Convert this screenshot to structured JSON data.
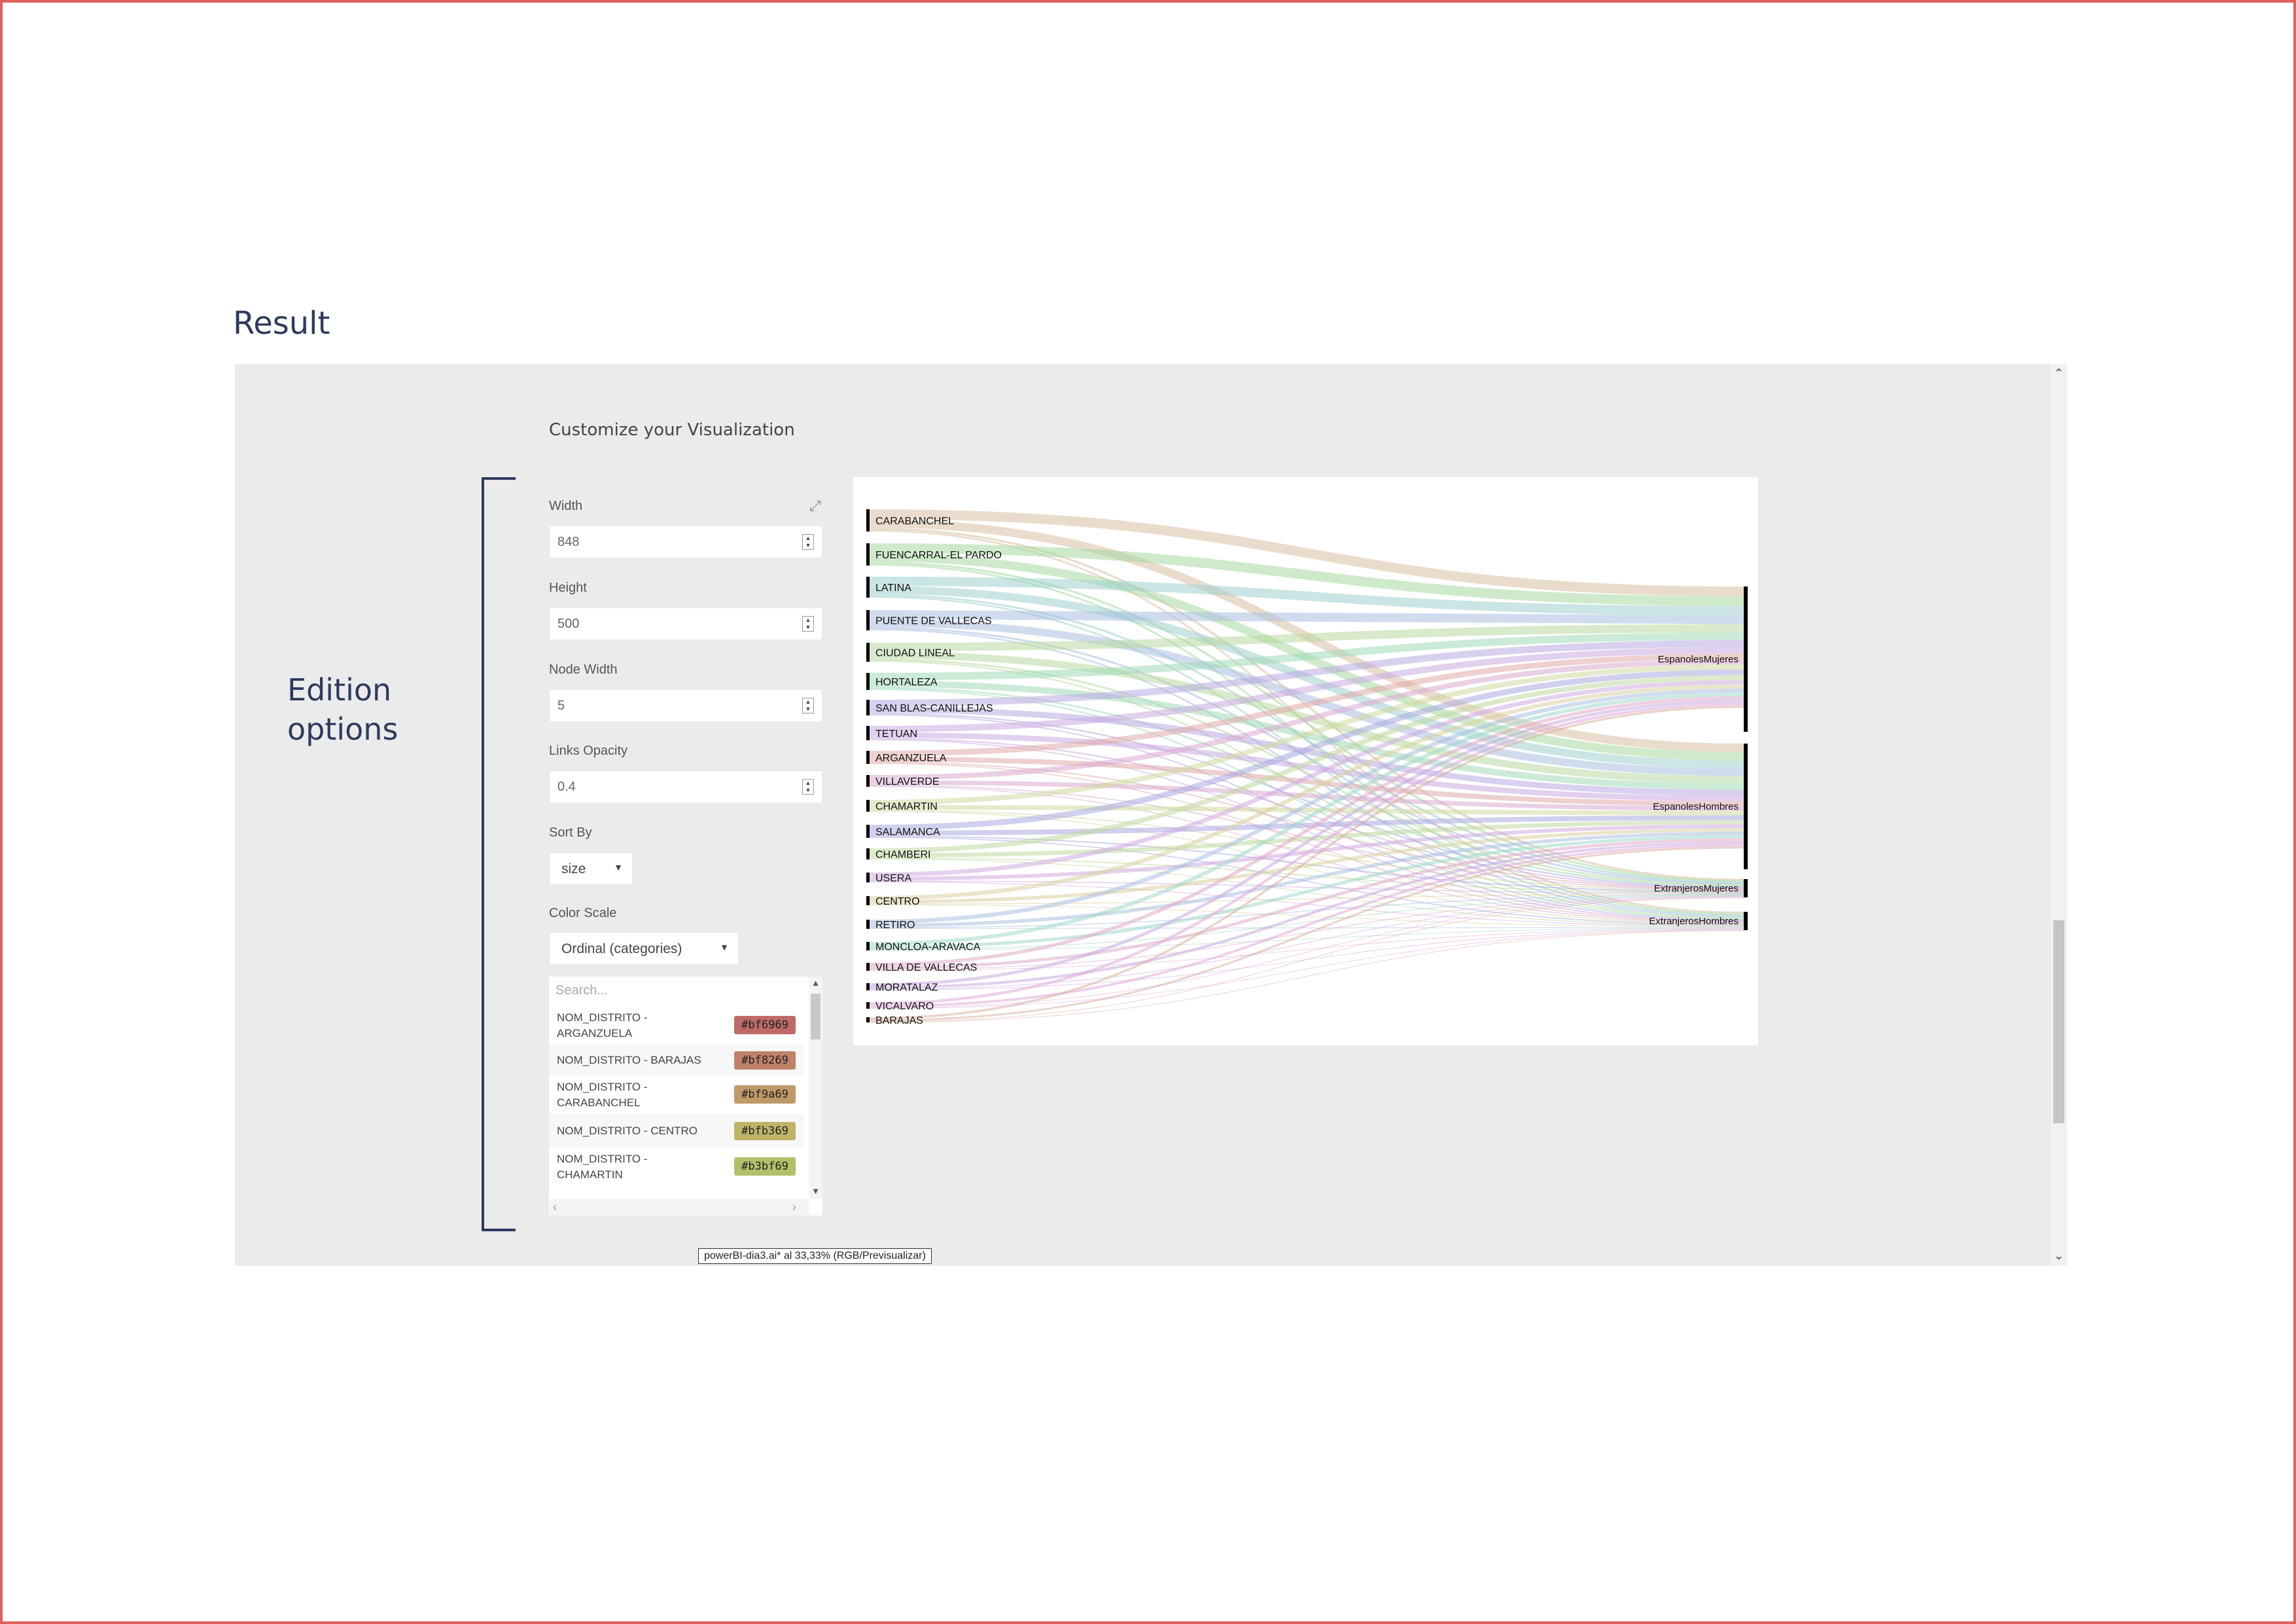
{
  "page": {
    "result_heading": "Result",
    "customize_heading": "Customize your Visualization",
    "edition_label_1": "Edition",
    "edition_label_2": "options"
  },
  "options": {
    "width": {
      "label": "Width",
      "value": "848"
    },
    "height": {
      "label": "Height",
      "value": "500"
    },
    "node_width": {
      "label": "Node Width",
      "value": "5"
    },
    "links_opacity": {
      "label": "Links Opacity",
      "value": "0.4"
    },
    "sort_by": {
      "label": "Sort By",
      "value": "size"
    },
    "color_scale": {
      "label": "Color Scale",
      "value": "Ordinal (categories)"
    }
  },
  "color_list": {
    "search_placeholder": "Search...",
    "items": [
      {
        "name_1": "NOM_DISTRITO -",
        "name_2": "ARGANZUELA",
        "color": "#bf6969"
      },
      {
        "name_1": "NOM_DISTRITO - BARAJAS",
        "name_2": "",
        "color": "#bf8269"
      },
      {
        "name_1": "NOM_DISTRITO -",
        "name_2": "CARABANCHEL",
        "color": "#bf9a69"
      },
      {
        "name_1": "NOM_DISTRITO - CENTRO",
        "name_2": "",
        "color": "#bfb369"
      },
      {
        "name_1": "NOM_DISTRITO -",
        "name_2": "CHAMARTIN",
        "color": "#b3bf69"
      }
    ]
  },
  "tooltip": "powerBI-dia3.ai* al 33,33% (RGB/Previsualizar)",
  "chart_data": {
    "type": "sankey",
    "sources": [
      {
        "name": "CARABANCHEL",
        "color": "#d8c0a4"
      },
      {
        "name": "FUENCARRAL-EL PARDO",
        "color": "#a6d8a0"
      },
      {
        "name": "LATINA",
        "color": "#9fd0cc"
      },
      {
        "name": "PUENTE DE VALLECAS",
        "color": "#a9bfe0"
      },
      {
        "name": "CIUDAD LINEAL",
        "color": "#b8d8a0"
      },
      {
        "name": "HORTALEZA",
        "color": "#a0d8b8"
      },
      {
        "name": "SAN BLAS-CANILLEJAS",
        "color": "#b8a9e0"
      },
      {
        "name": "TETUAN",
        "color": "#c9a9e0"
      },
      {
        "name": "ARGANZUELA",
        "color": "#e0a9a9"
      },
      {
        "name": "VILLAVERDE",
        "color": "#d8a9d0"
      },
      {
        "name": "CHAMARTIN",
        "color": "#cfd8a0"
      },
      {
        "name": "SALAMANCA",
        "color": "#a9a9e0"
      },
      {
        "name": "CHAMBERI",
        "color": "#c0d8a0"
      },
      {
        "name": "USERA",
        "color": "#d0a9e0"
      },
      {
        "name": "CENTRO",
        "color": "#d8d0a0"
      },
      {
        "name": "RETIRO",
        "color": "#a9c0e0"
      },
      {
        "name": "MONCLOA-ARAVACA",
        "color": "#a0d8c8"
      },
      {
        "name": "VILLA DE VALLECAS",
        "color": "#e0a9c8"
      },
      {
        "name": "MORATALAZ",
        "color": "#c8a9e0"
      },
      {
        "name": "VICALVARO",
        "color": "#e0a9d8"
      },
      {
        "name": "BARAJAS",
        "color": "#d8b0a0"
      }
    ],
    "targets": [
      {
        "name": "EspanolesMujeres"
      },
      {
        "name": "EspanolesHombres"
      },
      {
        "name": "ExtranjerosMujeres"
      },
      {
        "name": "ExtranjerosHombres"
      }
    ]
  }
}
